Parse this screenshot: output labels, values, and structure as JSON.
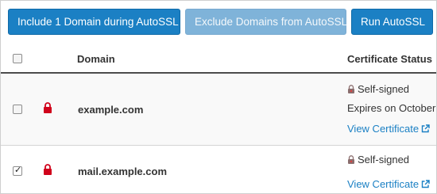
{
  "toolbar": {
    "include_label": "Include 1 Domain during AutoSSL",
    "exclude_label": "Exclude Domains from AutoSSL",
    "run_label": "Run AutoSSL"
  },
  "table": {
    "columns": {
      "domain": "Domain",
      "status": "Certificate Status"
    },
    "rows": [
      {
        "checked": false,
        "domain": "example.com",
        "status": "Self-signed",
        "expires": "Expires on October",
        "link": "View Certificate",
        "lock_icon": "lock-icon"
      },
      {
        "checked": true,
        "domain": "mail.example.com",
        "status": "Self-signed",
        "link": "View Certificate",
        "lock_icon": "lock-icon"
      }
    ]
  },
  "colors": {
    "primary_button": "#1b80c4",
    "disabled_button": "#7fb3d9",
    "lock_red": "#d0021b",
    "link": "#1b80c4"
  }
}
